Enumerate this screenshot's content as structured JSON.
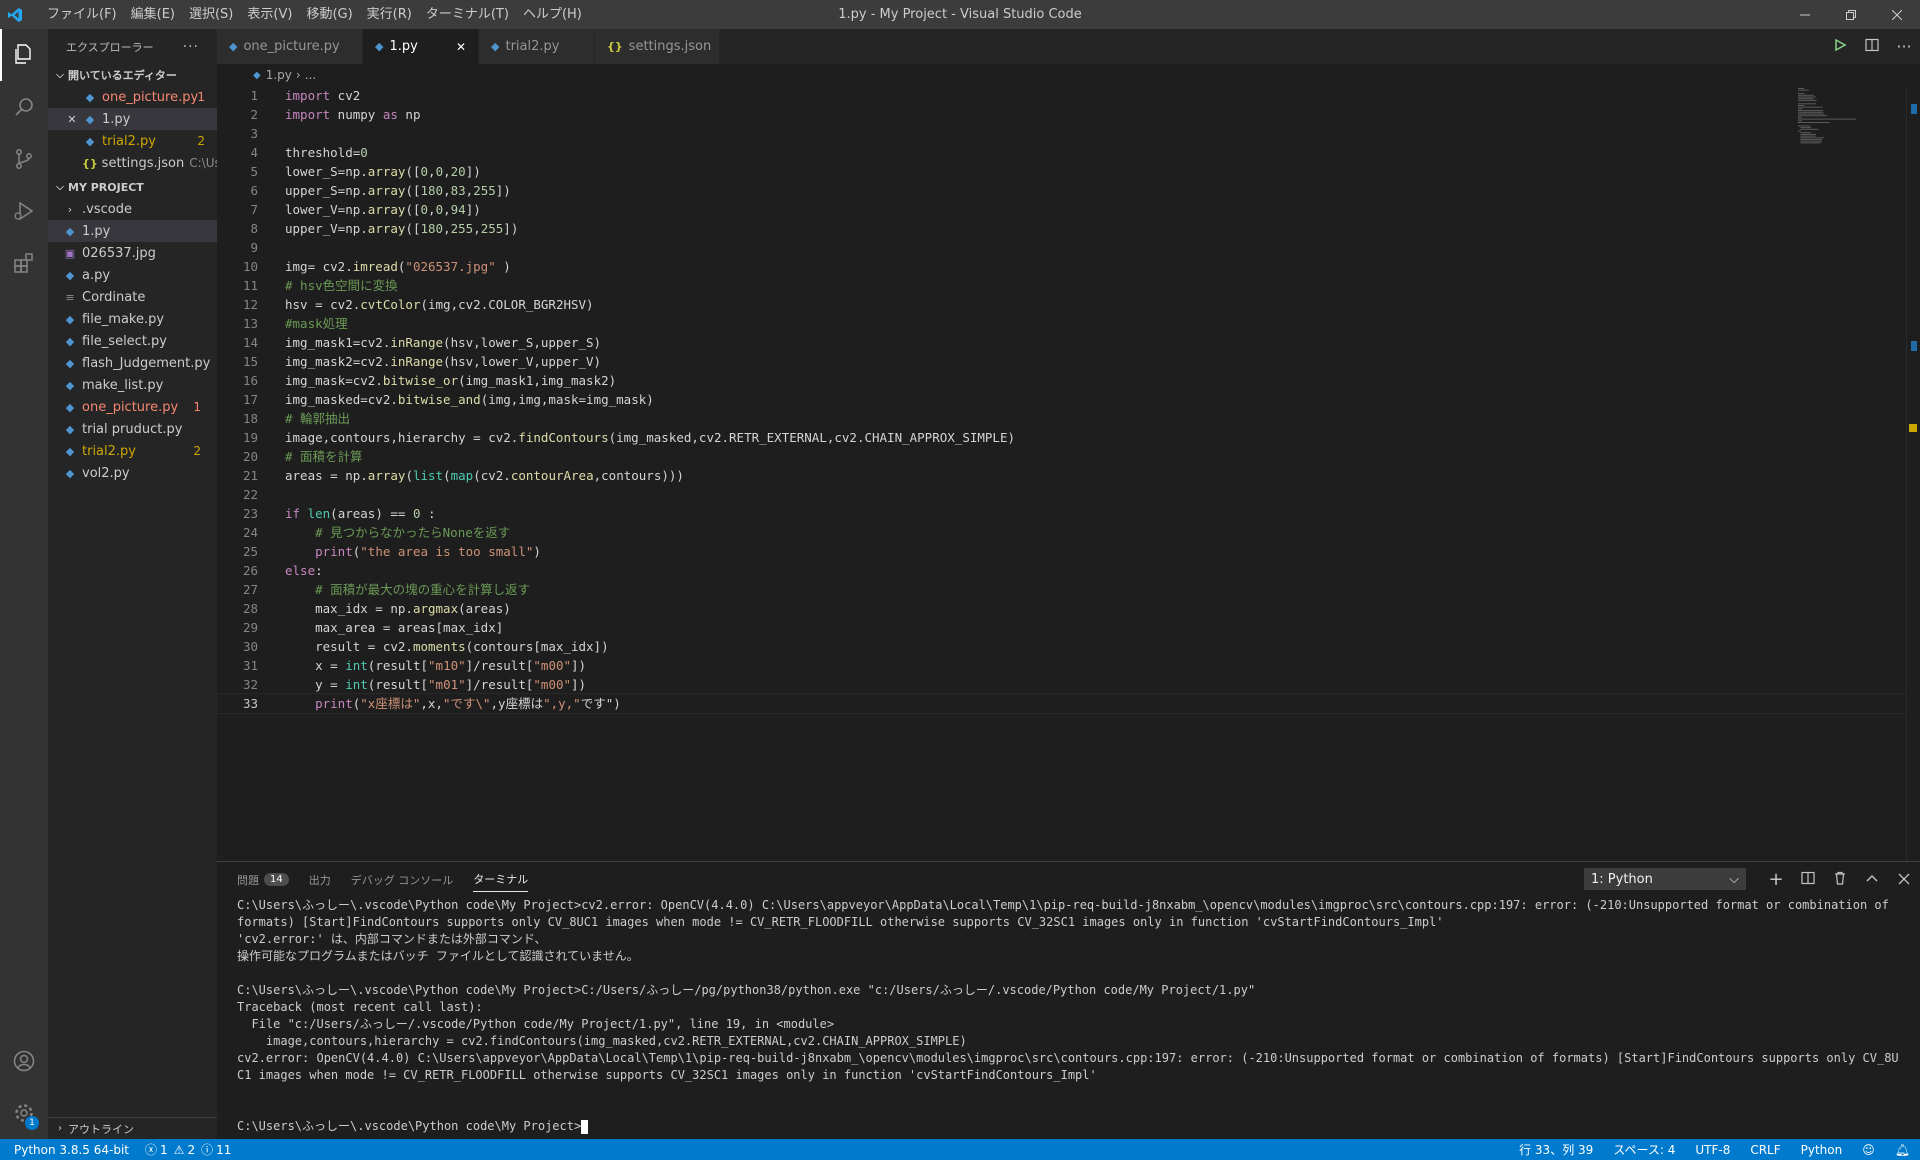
{
  "window": {
    "title": "1.py - My Project - Visual Studio Code",
    "menu": [
      "ファイル(F)",
      "編集(E)",
      "選択(S)",
      "表示(V)",
      "移動(G)",
      "実行(R)",
      "ターミナル(T)",
      "ヘルプ(H)"
    ]
  },
  "activity": {
    "account_badge": "1"
  },
  "sidebar": {
    "header": "エクスプローラー",
    "open_editors_title": "開いているエディター",
    "open_editors": [
      {
        "name": "one_picture.py",
        "count": "1"
      },
      {
        "name": "1.py",
        "count": ""
      },
      {
        "name": "trial2.py",
        "count": "2"
      },
      {
        "name": "settings.json",
        "path": "C:\\Us..."
      }
    ],
    "project_title": "MY PROJECT",
    "files": [
      {
        "name": ".vscode",
        "count": ""
      },
      {
        "name": "1.py",
        "count": ""
      },
      {
        "name": "026537.jpg",
        "count": ""
      },
      {
        "name": "a.py",
        "count": ""
      },
      {
        "name": "Cordinate",
        "count": ""
      },
      {
        "name": "file_make.py",
        "count": ""
      },
      {
        "name": "file_select.py",
        "count": ""
      },
      {
        "name": "flash_Judgement.py",
        "count": ""
      },
      {
        "name": "make_list.py",
        "count": ""
      },
      {
        "name": "one_picture.py",
        "count": "1"
      },
      {
        "name": "trial pruduct.py",
        "count": ""
      },
      {
        "name": "trial2.py",
        "count": "2"
      },
      {
        "name": "vol2.py",
        "count": ""
      }
    ],
    "outline_title": "アウトライン"
  },
  "tabs": [
    "one_picture.py",
    "1.py",
    "trial2.py",
    "settings.json"
  ],
  "breadcrumb": {
    "file": "1.py",
    "rest": "..."
  },
  "editor": {
    "line_numbers": [
      "1",
      "2",
      "3",
      "4",
      "5",
      "6",
      "7",
      "8",
      "9",
      "10",
      "11",
      "12",
      "13",
      "14",
      "15",
      "16",
      "17",
      "18",
      "19",
      "20",
      "21",
      "22",
      "23",
      "24",
      "25",
      "26",
      "27",
      "28",
      "29",
      "30",
      "31",
      "32",
      "33"
    ],
    "lines": [
      "import cv2",
      "import numpy as np",
      "",
      "threshold=0",
      "lower_S=np.array([0,0,20])",
      "upper_S=np.array([180,83,255])",
      "lower_V=np.array([0,0,94])",
      "upper_V=np.array([180,255,255])",
      "",
      "img= cv2.imread(\"026537.jpg\" )",
      "# hsv色空間に変換",
      "hsv = cv2.cvtColor(img,cv2.COLOR_BGR2HSV)",
      "#mask処理",
      "img_mask1=cv2.inRange(hsv,lower_S,upper_S)",
      "img_mask2=cv2.inRange(hsv,lower_V,upper_V)",
      "img_mask=cv2.bitwise_or(img_mask1,img_mask2)",
      "img_masked=cv2.bitwise_and(img,img,mask=img_mask)",
      "# 輪郭抽出",
      "image,contours,hierarchy = cv2.findContours(img_masked,cv2.RETR_EXTERNAL,cv2.CHAIN_APPROX_SIMPLE)",
      "# 面積を計算",
      "areas = np.array(list(map(cv2.contourArea,contours)))",
      "",
      "if len(areas) == 0 :",
      "    # 見つからなかったらNoneを返す",
      "    print(\"the area is too small\")",
      "else:",
      "    # 面積が最大の塊の重心を計算し返す",
      "    max_idx = np.argmax(areas)",
      "    max_area = areas[max_idx]",
      "    result = cv2.moments(contours[max_idx])",
      "    x = int(result[\"m10\"]/result[\"m00\"])",
      "    y = int(result[\"m01\"]/result[\"m00\"])",
      "    print(\"x座標は\",x,\"です\\\",y座標は\",y,\"です\")"
    ]
  },
  "panel": {
    "tabs": [
      "問題",
      "出力",
      "デバッグ コンソール",
      "ターミナル"
    ],
    "problems_count": "14",
    "terminal_select": "1: Python",
    "terminal_text": "C:\\Users\\ふっしー\\.vscode\\Python code\\My Project>cv2.error: OpenCV(4.4.0) C:\\Users\\appveyor\\AppData\\Local\\Temp\\1\\pip-req-build-j8nxabm_\\opencv\\modules\\imgproc\\src\\contours.cpp:197: error: (-210:Unsupported format or combination of formats) [Start]FindContours supports only CV_8UC1 images when mode != CV_RETR_FLOODFILL otherwise supports CV_32SC1 images only in function 'cvStartFindContours_Impl'\n'cv2.error:' は、内部コマンドまたは外部コマンド、\n操作可能なプログラムまたはバッチ ファイルとして認識されていません。\n\nC:\\Users\\ふっしー\\.vscode\\Python code\\My Project>C:/Users/ふっしー/pg/python38/python.exe \"c:/Users/ふっしー/.vscode/Python code/My Project/1.py\"\nTraceback (most recent call last):\n  File \"c:/Users/ふっしー/.vscode/Python code/My Project/1.py\", line 19, in <module>\n    image,contours,hierarchy = cv2.findContours(img_masked,cv2.RETR_EXTERNAL,cv2.CHAIN_APPROX_SIMPLE)\ncv2.error: OpenCV(4.4.0) C:\\Users\\appveyor\\AppData\\Local\\Temp\\1\\pip-req-build-j8nxabm_\\opencv\\modules\\imgproc\\src\\contours.cpp:197: error: (-210:Unsupported format or combination of formats) [Start]FindContours supports only CV_8UC1 images when mode != CV_RETR_FLOODFILL otherwise supports CV_32SC1 images only in function 'cvStartFindContours_Impl'\n\n\n",
    "prompt": "C:\\Users\\ふっしー\\.vscode\\Python code\\My Project>"
  },
  "status": {
    "interpreter": "Python 3.8.5 64-bit",
    "errors": "1",
    "warnings": "2",
    "infos": "11",
    "position": "行 33、列 39",
    "spaces": "スペース: 4",
    "encoding": "UTF-8",
    "eol": "CRLF",
    "language": "Python"
  }
}
